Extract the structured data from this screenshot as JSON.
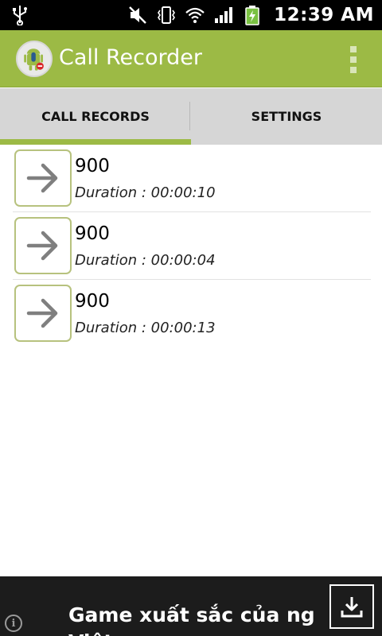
{
  "status_bar": {
    "time": "12:39 AM",
    "icons": [
      "usb-icon",
      "mute-icon",
      "vibrate-icon",
      "wifi-icon",
      "signal-icon",
      "battery-charging-icon"
    ]
  },
  "app": {
    "title": "Call Recorder",
    "icon": "call-recorder-app-icon",
    "accent_color": "#9cba45"
  },
  "tabs": [
    {
      "label": "CALL RECORDS",
      "active": true
    },
    {
      "label": "SETTINGS",
      "active": false
    }
  ],
  "records": [
    {
      "number": "900",
      "duration": "Duration : 00:00:10",
      "icon": "arrow-right-icon"
    },
    {
      "number": "900",
      "duration": "Duration : 00:00:04",
      "icon": "arrow-right-icon"
    },
    {
      "number": "900",
      "duration": "Duration : 00:00:13",
      "icon": "arrow-right-icon"
    }
  ],
  "ad": {
    "text": "Game xuất sắc của ng Việt",
    "info_label": "i",
    "icons": [
      "info-icon",
      "download-icon"
    ]
  }
}
